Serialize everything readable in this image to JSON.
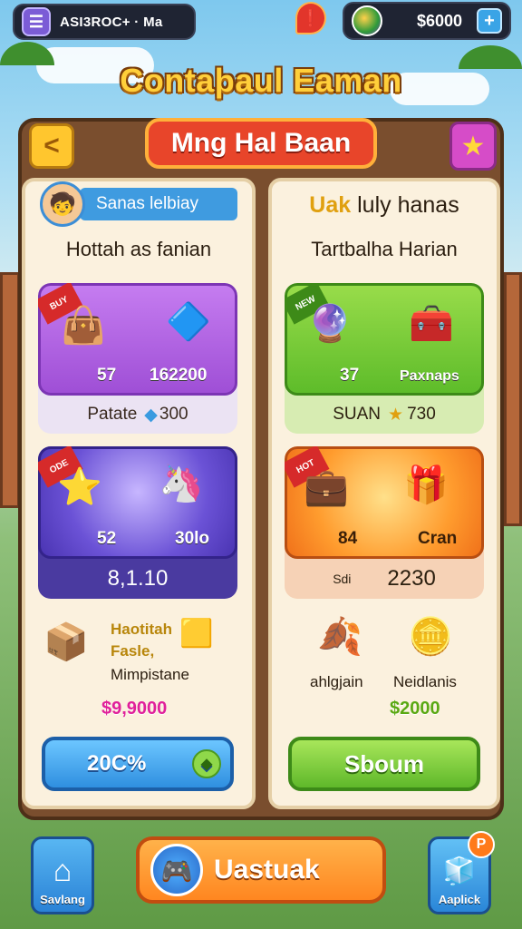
{
  "topbar": {
    "menu_icon": "menu-icon",
    "account_label": "ASI3ROC+ · Ma",
    "notification_icon": "notification-icon",
    "coin_balance": "$6000",
    "add_coins_label": "+"
  },
  "title": "Contaþaul Eaman",
  "nav": {
    "back_label": "<",
    "ribbon_label": "Mng Hal Baan",
    "favorite_icon": "star-icon"
  },
  "left_panel": {
    "player_name": "Sanas lelbiay",
    "subtitle": "Hottah as fanian",
    "card1": {
      "tag": "BUY",
      "left_value": "57",
      "right_value": "162200",
      "footer_label": "Patate",
      "footer_value": "300"
    },
    "card2": {
      "tag": "ODE",
      "left_value": "52",
      "right_value": "30lo",
      "footer_value": "8,1.10"
    },
    "reward": {
      "line1": "Haotitah",
      "line2": "Fasle,",
      "line3": "Mimpistane",
      "price": "$9,9000"
    },
    "button_label": "20C%"
  },
  "right_panel": {
    "header_highlight": "Uak",
    "header_rest": "luly hanas",
    "subtitle": "Tartbalha Harian",
    "card1": {
      "tag": "NEW",
      "left_value": "37",
      "right_value": "Paxnaps",
      "footer_label": "SUAN",
      "footer_value": "730"
    },
    "card2": {
      "tag": "HOT",
      "left_value": "84",
      "right_value": "Cran",
      "footer_label": "Sdi",
      "footer_value": "2230"
    },
    "reward_left_label": "ahlgjain",
    "reward_right_label": "Neidlanis",
    "price": "$2000",
    "button_label": "Sboum"
  },
  "bottom_nav": {
    "home_label": "Savlang",
    "main_label": "Uastuak",
    "right_label": "Aaplick",
    "right_badge": "P"
  },
  "colors": {
    "accent_purple": "#9f4fd6",
    "accent_green": "#5ebc2a",
    "accent_orange": "#ff8620",
    "accent_blue": "#2f8fe0",
    "title_gold": "#ffcf3a"
  }
}
